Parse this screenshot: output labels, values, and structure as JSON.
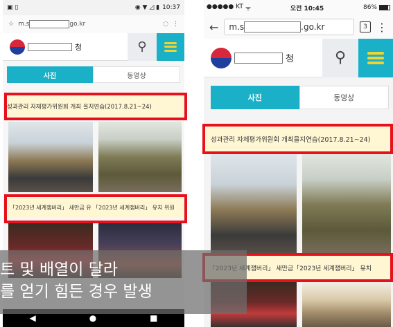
{
  "left_phone": {
    "status": {
      "icons_left": "▣ ▯",
      "icons_right": "◉ ▼ ◿ ▮",
      "time": "10:37"
    },
    "browser": {
      "star_icon": "☆",
      "url_prefix": "m.s",
      "url_suffix": "go.kr",
      "reload_icon": "◌",
      "menu_icon": "⋮"
    },
    "site": {
      "title_suffix": "청",
      "search_icon": "⚲"
    },
    "tabs": [
      {
        "label": "사진"
      },
      {
        "label": "동영상"
      }
    ],
    "captions": {
      "first": "성과관리 자체평가위원회 개최       을지연습(2017.8.21~24)",
      "second": "「2023년 세계잼버리」 새만금 유  「2023년 세계잼버리」 유치 위원"
    },
    "nav": {
      "back": "◀",
      "home": "●",
      "recent": "■"
    }
  },
  "right_phone": {
    "status": {
      "carrier": "●●●●● KT",
      "wifi": "ᯤ",
      "time": "오전 10:45",
      "battery": "86%"
    },
    "browser": {
      "back_icon": "←",
      "url_prefix": "m.s",
      "url_suffix": ".go.kr",
      "tab_count": "3",
      "menu_icon": "⋮"
    },
    "site": {
      "title_suffix": "청",
      "search_icon": "⚲"
    },
    "tabs": [
      {
        "label": "사진"
      },
      {
        "label": "동영상"
      }
    ],
    "captions": {
      "first": "성과관리 자체평가위원회 개최을지연습(2017.8.21~24)",
      "second": "「2023년 세계잼버리」 새만금「2023년 세계잼버리」 유치"
    }
  },
  "overlay": {
    "line1": "트 및 배열이 달라",
    "line2": "를 얻기 힘든 경우 발생"
  },
  "colors": {
    "accent": "#19b0c8",
    "menu_bars": "#f4d32e",
    "highlight": "#e8101a",
    "caption_bg": "#fff6d4"
  }
}
